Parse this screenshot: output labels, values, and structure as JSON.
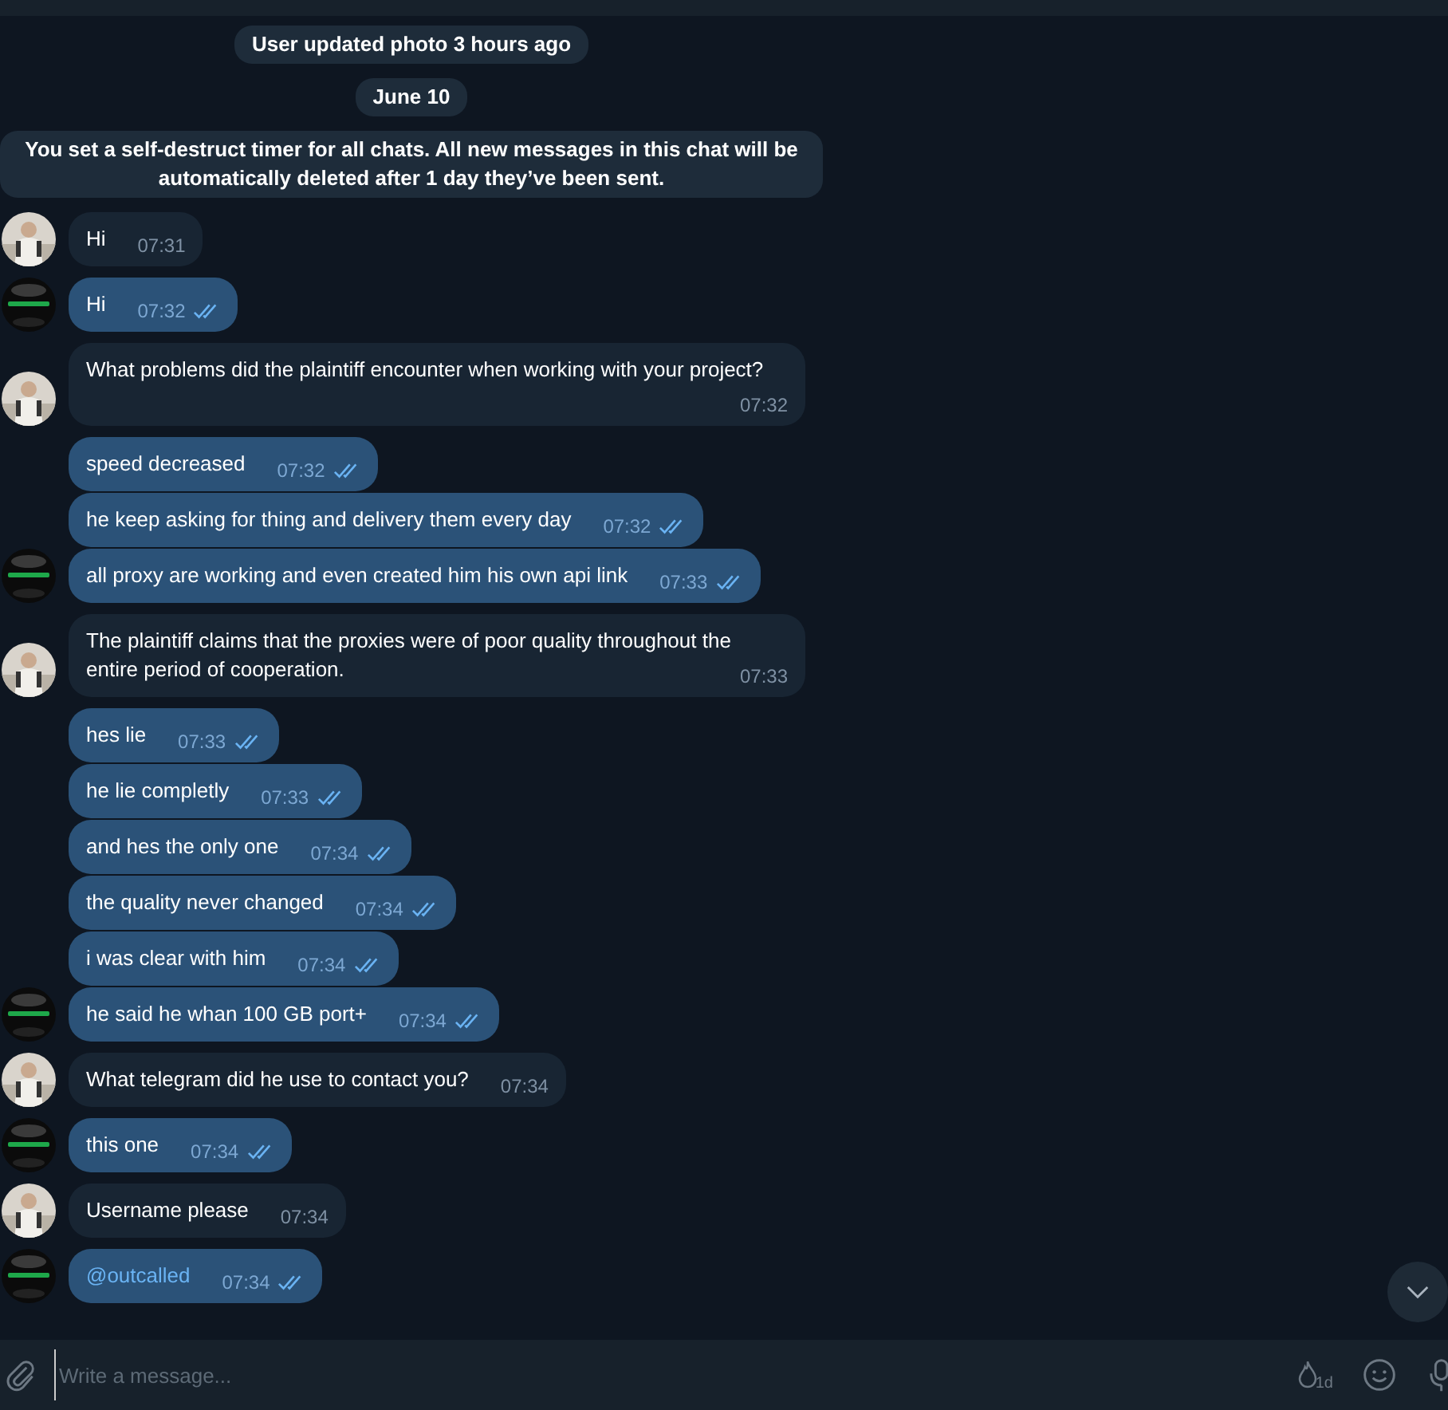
{
  "messages": [
    {
      "kind": "service",
      "text": "User updated photo 3 hours ago"
    },
    {
      "kind": "service",
      "text": "June 10"
    },
    {
      "kind": "service",
      "text": "You set a self-destruct timer for all chats. All new messages in this chat will be automatically deleted after 1 day they’ve been sent."
    },
    {
      "kind": "incoming",
      "text": "Hi",
      "time": "07:31",
      "avatar": true
    },
    {
      "kind": "outgoing",
      "text": "Hi",
      "time": "07:32",
      "read": true,
      "avatar": true
    },
    {
      "kind": "incoming",
      "text": "What problems did the plaintiff encounter when working with your project?",
      "time": "07:32",
      "avatar": true
    },
    {
      "kind": "outgoing",
      "text": "speed decreased",
      "time": "07:32",
      "read": true,
      "avatar": false
    },
    {
      "kind": "outgoing",
      "text": "he keep asking for thing and delivery them every day",
      "time": "07:32",
      "read": true,
      "avatar": false
    },
    {
      "kind": "outgoing",
      "text": "all proxy are working and even created him his own api link",
      "time": "07:33",
      "read": true,
      "avatar": true
    },
    {
      "kind": "incoming",
      "text": "The plaintiff claims that the proxies were of poor quality throughout the entire period of cooperation.",
      "time": "07:33",
      "avatar": true
    },
    {
      "kind": "outgoing",
      "text": "hes lie",
      "time": "07:33",
      "read": true,
      "avatar": false
    },
    {
      "kind": "outgoing",
      "text": "he lie completly",
      "time": "07:33",
      "read": true,
      "avatar": false
    },
    {
      "kind": "outgoing",
      "text": "and hes the only one",
      "time": "07:34",
      "read": true,
      "avatar": false
    },
    {
      "kind": "outgoing",
      "text": "the quality never changed",
      "time": "07:34",
      "read": true,
      "avatar": false
    },
    {
      "kind": "outgoing",
      "text": "i was clear with him",
      "time": "07:34",
      "read": true,
      "avatar": false
    },
    {
      "kind": "outgoing",
      "text": "he said he whan 100 GB port+",
      "time": "07:34",
      "read": true,
      "avatar": true
    },
    {
      "kind": "incoming",
      "text": "What telegram did he use to contact you?",
      "time": "07:34",
      "avatar": true
    },
    {
      "kind": "outgoing",
      "text": "this one",
      "time": "07:34",
      "read": true,
      "avatar": true
    },
    {
      "kind": "incoming",
      "text": "Username please",
      "time": "07:34",
      "avatar": true
    },
    {
      "kind": "outgoing",
      "text": "@outcalled",
      "time": "07:34",
      "read": true,
      "avatar": true,
      "link": true
    }
  ],
  "composer": {
    "placeholder": "Write a message...",
    "timer_label": "1d"
  }
}
